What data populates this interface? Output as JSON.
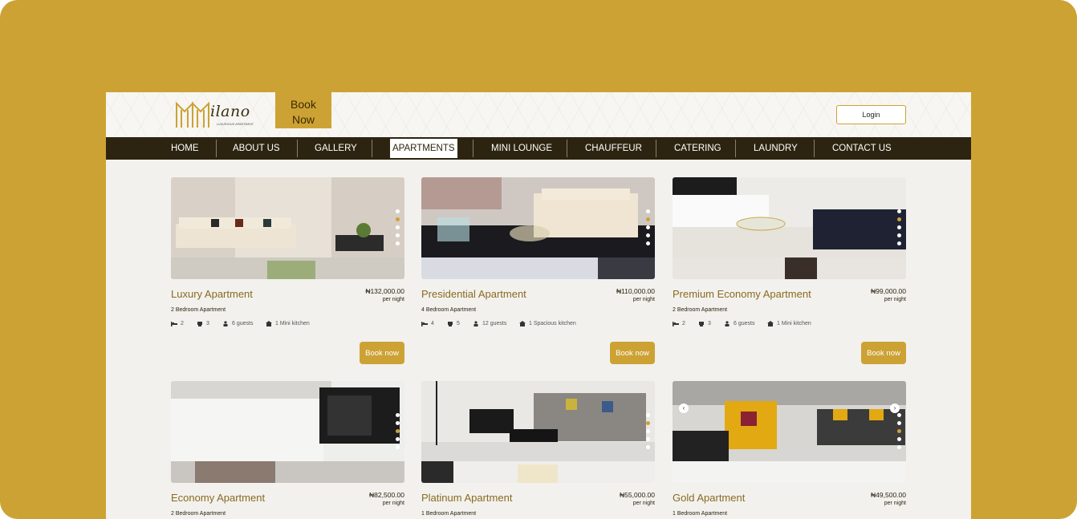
{
  "brand": {
    "name": "ilano",
    "tagline": "LUXURIOUS APARTMENT"
  },
  "header": {
    "book_now": "Book Now",
    "login": "Login"
  },
  "nav": [
    "HOME",
    "ABOUT US",
    "GALLERY",
    "APARTMENTS",
    "MINI LOUNGE",
    "CHAUFFEUR",
    "CATERING",
    "LAUNDRY",
    "CONTACT US"
  ],
  "nav_active": "APARTMENTS",
  "colors": {
    "gold": "#cda234",
    "dark": "#2c2410",
    "title": "#8a6a1f"
  },
  "cards": [
    {
      "title": "Luxury Apartment",
      "price": "₦132,000.00",
      "per": "per night",
      "subtitle": "2 Bedroom Apartment",
      "beds": "2",
      "baths": "3",
      "guests": "6 guests",
      "kitchen": "1 Mini kitchen",
      "button": "Book now"
    },
    {
      "title": "Presidential Apartment",
      "price": "₦110,000.00",
      "per": "per night",
      "subtitle": "4 Bedroom Apartment",
      "beds": "4",
      "baths": "5",
      "guests": "12 guests",
      "kitchen": "1 Spacious kitchen",
      "button": "Book now"
    },
    {
      "title": "Premium Economy Apartment",
      "price": "₦99,000.00",
      "per": "per night",
      "subtitle": "2 Bedroom Apartment",
      "beds": "2",
      "baths": "3",
      "guests": "6 guests",
      "kitchen": "1 Mini kitchen",
      "button": "Book now"
    },
    {
      "title": "Economy Apartment",
      "price": "₦82,500.00",
      "per": "per night",
      "subtitle": "2 Bedroom Apartment"
    },
    {
      "title": "Platinum Apartment",
      "price": "₦55,000.00",
      "per": "per night",
      "subtitle": "1 Bedroom Apartment"
    },
    {
      "title": "Gold Apartment",
      "price": "₦49,500.00",
      "per": "per night",
      "subtitle": "1 Bedroom Apartment"
    }
  ],
  "icons": {
    "beds": "bed-icon",
    "baths": "bath-icon",
    "guests": "person-icon",
    "kitchen": "kitchen-icon",
    "prev": "chevron-left-icon",
    "next": "chevron-right-icon"
  }
}
